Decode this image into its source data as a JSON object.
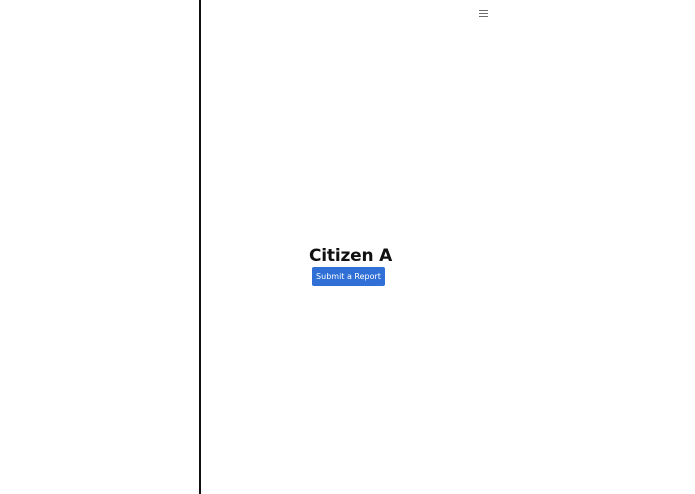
{
  "header": {
    "menu_icon": "hamburger-menu-icon"
  },
  "main": {
    "title": "Citizen A",
    "submit_button": "Submit a Report"
  },
  "colors": {
    "background": "#ffffff",
    "divider": "#111111",
    "button": "#2f6fd6",
    "button_text": "#ffffff",
    "title_text": "#111111",
    "menu_icon": "#6b6b6b"
  }
}
